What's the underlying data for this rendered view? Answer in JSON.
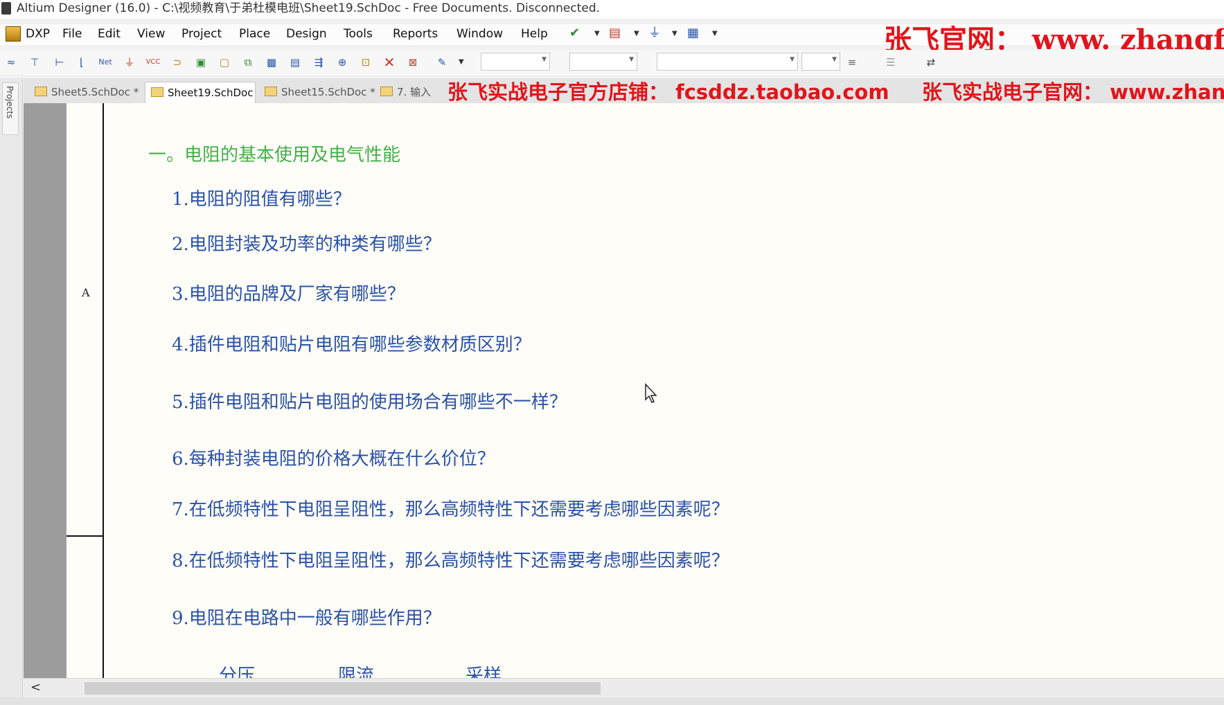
{
  "window": {
    "title": "Altium Designer (16.0) - C:\\视频教育\\于弟杜模电班\\Sheet19.SchDoc - Free Documents. Disconnected."
  },
  "menu": {
    "items": [
      "DXP",
      "File",
      "Edit",
      "View",
      "Project",
      "Place",
      "Design",
      "Tools",
      "Reports",
      "Window",
      "Help"
    ]
  },
  "watermarks": {
    "top_right": "张飞官网： www. zhangf",
    "store": "张飞实战电子官方店铺： fcsddz.taobao.com",
    "site": "张飞实战电子官网： www.zhan"
  },
  "side_panel": {
    "projects_label": "Projects"
  },
  "tabs": [
    {
      "label": "Sheet5.SchDoc *",
      "active": false
    },
    {
      "label": "Sheet19.SchDoc",
      "active": true
    },
    {
      "label": "Sheet15.SchDoc *",
      "active": false
    },
    {
      "label": "7.  输入",
      "active": false
    }
  ],
  "sheet": {
    "zone_label": "A",
    "heading": "一。电阻的基本使用及电气性能",
    "questions": [
      "1.电阻的阻值有哪些？",
      "2.电阻封装及功率的种类有哪些？",
      "3.电阻的品牌及厂家有哪些？",
      "4.插件电阻和贴片电阻有哪些参数材质区别？",
      "5.插件电阻和贴片电阻的使用场合有哪些不一样？",
      "6.每种封装电阻的价格大概在什么价位？",
      "7.在低频特性下电阻呈阻性，那么高频特性下还需要考虑哪些因素呢？",
      "8.在低频特性下电阻呈阻性，那么高频特性下还需要考虑哪些因素呢？",
      "9.电阻在电路中一般有哪些作用？"
    ],
    "answers": [
      "分压",
      "限流",
      "采样"
    ]
  },
  "scrollbar": {
    "left_arrow": "<"
  }
}
